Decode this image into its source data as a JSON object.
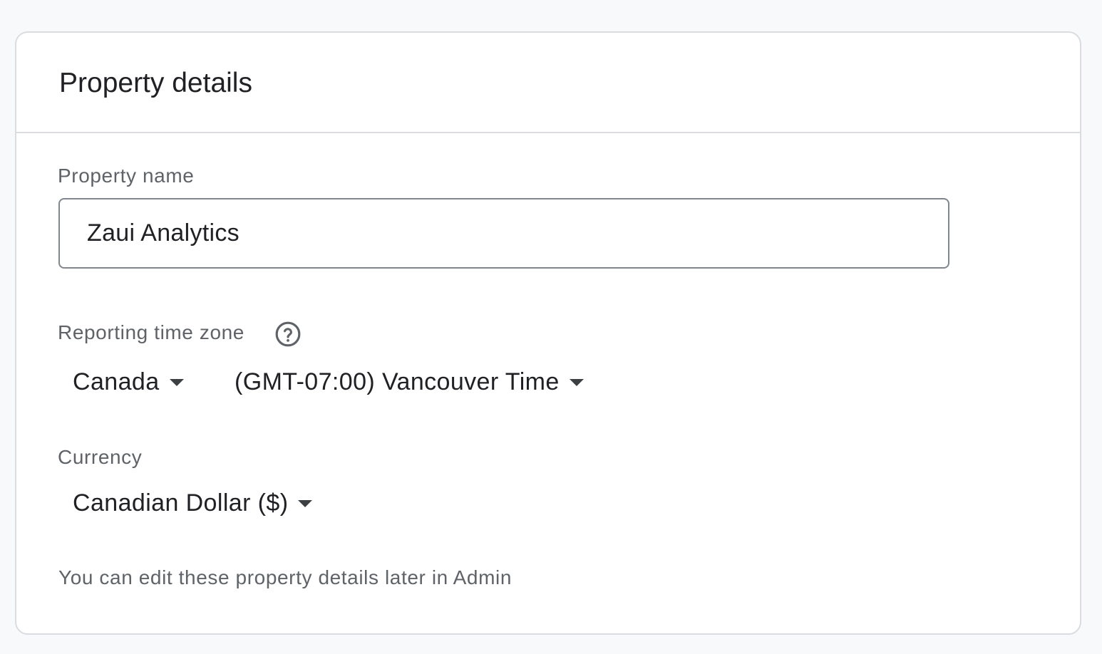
{
  "card": {
    "title": "Property details"
  },
  "property_name": {
    "label": "Property name",
    "value": "Zaui Analytics"
  },
  "time_zone": {
    "label": "Reporting time zone",
    "help_icon": "help-circle-icon",
    "country": "Canada",
    "zone": "(GMT-07:00) Vancouver Time"
  },
  "currency": {
    "label": "Currency",
    "value": "Canadian Dollar ($)"
  },
  "hint": "You can edit these property details later in Admin",
  "colors": {
    "background": "#f8f9fa",
    "card": "#ffffff",
    "border": "#dadce0",
    "label": "#5f6368",
    "text": "#202124"
  }
}
